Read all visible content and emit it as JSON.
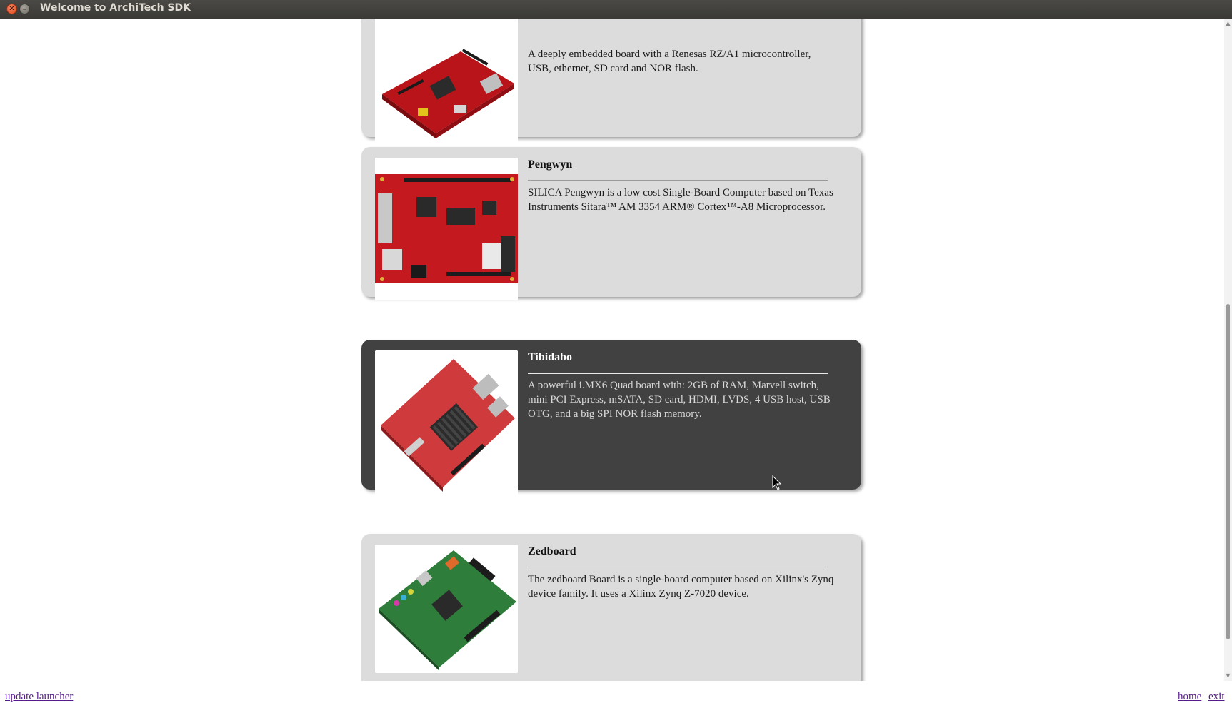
{
  "window": {
    "title": "Welcome to ArchiTech SDK"
  },
  "boards": [
    {
      "name": "",
      "description": "A deeply embedded board with a Renesas RZ/A1 microcontroller, USB, ethernet, SD card and NOR flash.",
      "image_icon": "red-board-image",
      "active": false
    },
    {
      "name": "Pengwyn",
      "description": "SILICA Pengwyn is a low cost Single-Board Computer based on Texas Instruments Sitara™ AM 3354 ARM® Cortex™-A8 Microprocessor.",
      "image_icon": "red-board-image",
      "active": false
    },
    {
      "name": "Tibidabo",
      "description": "A powerful i.MX6 Quad board with: 2GB of RAM, Marvell switch, mini PCI Express, mSATA, SD card, HDMI, LVDS, 4 USB host, USB OTG, and a big SPI NOR flash memory.",
      "image_icon": "red-board-image",
      "active": true
    },
    {
      "name": "Zedboard",
      "description": "The zedboard Board is a single-board computer based on Xilinx's Zynq device family. It uses a Xilinx Zynq Z-7020 device.",
      "image_icon": "green-board-image",
      "active": false
    }
  ],
  "footer": {
    "update_label": "update launcher",
    "home_label": "home",
    "exit_label": "exit"
  },
  "colors": {
    "card_bg": "#dcdcdc",
    "card_active_bg": "#414141",
    "board_red": "#c8171c",
    "board_green": "#2e7d3a",
    "link": "#551a8b"
  }
}
